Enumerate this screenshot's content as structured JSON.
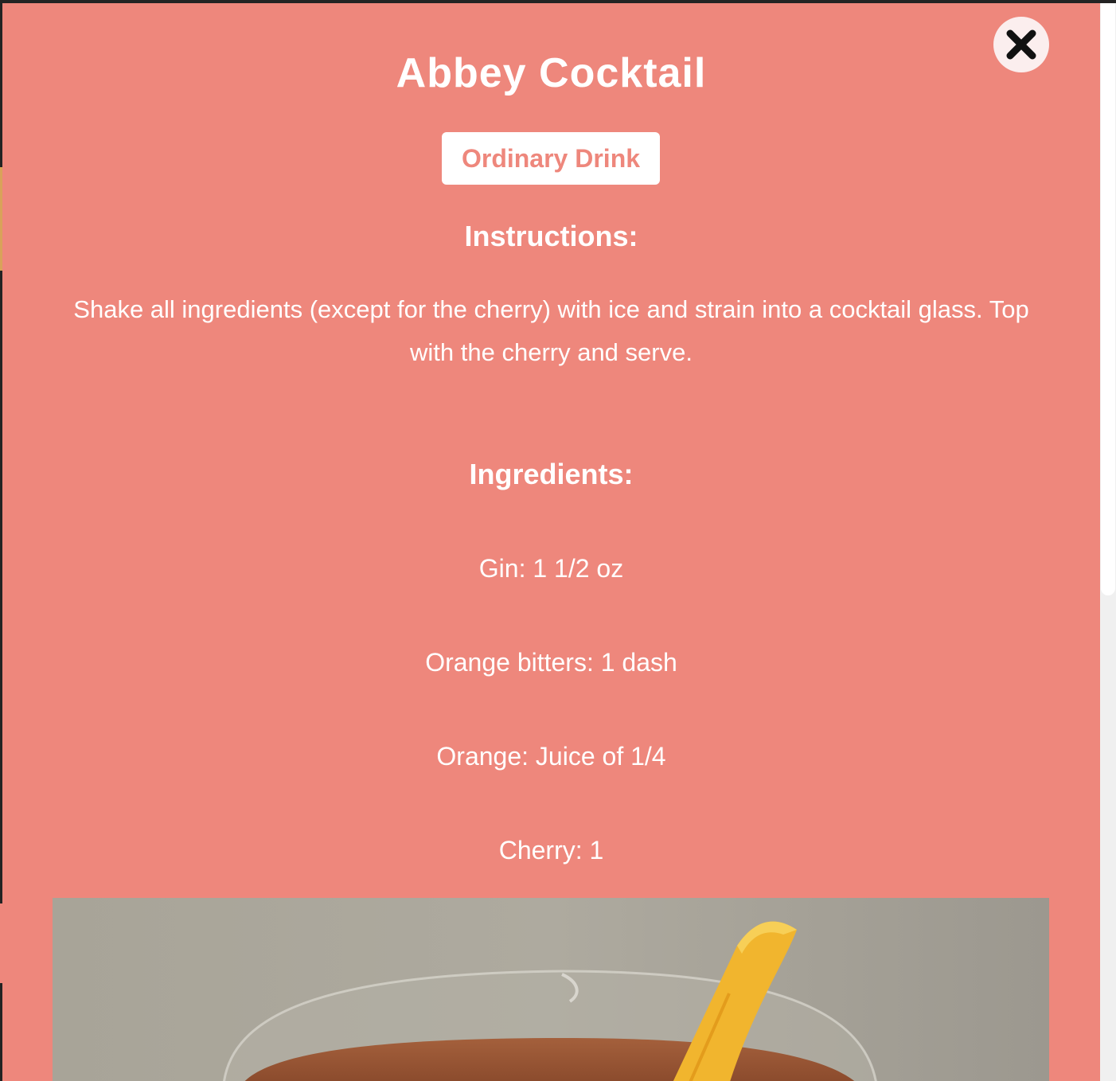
{
  "modal": {
    "title": "Abbey Cocktail",
    "category": "Ordinary Drink",
    "instructions_heading": "Instructions:",
    "instructions": "Shake all ingredients (except for the cherry) with ice and strain into a cocktail glass. Top with the cherry and serve.",
    "ingredients_heading": "Ingredients:",
    "ingredients": [
      "Gin: 1 1/2 oz",
      "Orange bitters: 1 dash",
      "Orange: Juice of 1/4",
      "Cherry: 1"
    ],
    "close_icon": "close-icon",
    "photo_subject": "cocktail-photo"
  },
  "colors": {
    "modal_background": "#ee877c",
    "text": "#ffffff",
    "badge_background": "#ffffff",
    "badge_text": "#ee877c",
    "close_button_background": "#fbeeee",
    "close_icon": "#111111"
  }
}
